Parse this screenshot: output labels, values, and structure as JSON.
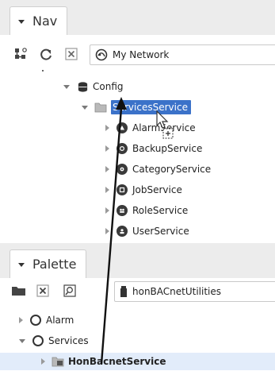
{
  "nav": {
    "title": "Nav",
    "toolbar": {
      "combo_value": "My Network",
      "icons": [
        "hierarchy-icon",
        "refresh-icon",
        "close-icon",
        "network-globe-icon"
      ]
    },
    "tree": [
      {
        "label": "Config",
        "icon": "config-icon",
        "expanded": true
      },
      {
        "label": "ServicesService",
        "icon": "folder-icon",
        "expanded": true,
        "selected": true,
        "partial_visible": "Servi…Service"
      },
      {
        "label": "AlarmService",
        "icon": "alarm-icon"
      },
      {
        "label": "BackupService",
        "icon": "backup-icon"
      },
      {
        "label": "CategoryService",
        "icon": "category-icon"
      },
      {
        "label": "JobService",
        "icon": "job-icon"
      },
      {
        "label": "RoleService",
        "icon": "role-icon"
      },
      {
        "label": "UserService",
        "icon": "user-icon"
      }
    ],
    "selected_label": "Services",
    "selected_label_suffix": "Service"
  },
  "palette": {
    "title": "Palette",
    "toolbar": {
      "combo_value": "honBACnetUtilities"
    },
    "tree": [
      {
        "label": "Alarm",
        "icon": "alarm-circle-icon",
        "expanded": false
      },
      {
        "label": "Services",
        "icon": "services-circle-icon",
        "expanded": true
      },
      {
        "label": "HonBacnetService",
        "icon": "folder-service-icon",
        "highlighted": true
      }
    ]
  },
  "colors": {
    "selection": "#3b72c9",
    "row_highlight": "#e2ecfa",
    "arrow": "#111111"
  }
}
